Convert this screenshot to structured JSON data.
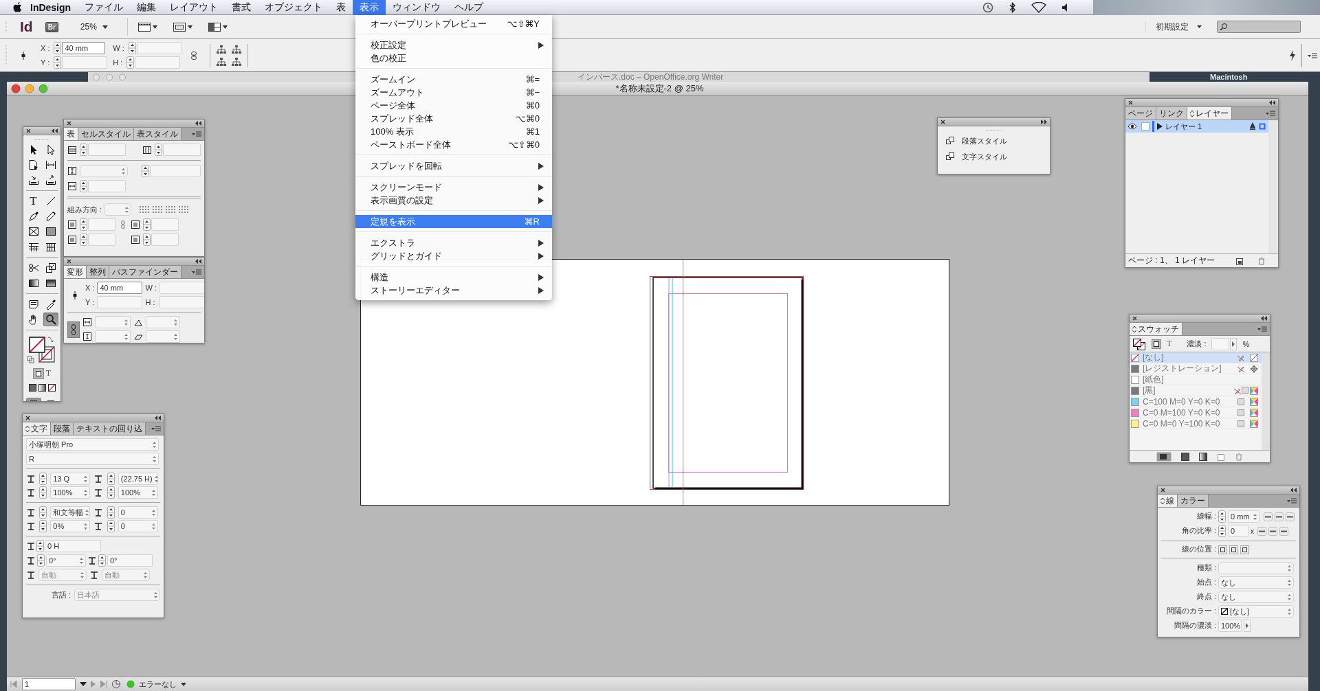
{
  "menubar": {
    "items": [
      {
        "label": "InDesign",
        "selected": false
      },
      {
        "label": "ファイル",
        "selected": false
      },
      {
        "label": "編集",
        "selected": false
      },
      {
        "label": "レイアウト",
        "selected": false
      },
      {
        "label": "書式",
        "selected": false
      },
      {
        "label": "オブジェクト",
        "selected": false
      },
      {
        "label": "表",
        "selected": false
      },
      {
        "label": "表示",
        "selected": true
      },
      {
        "label": "ウィンドウ",
        "selected": false
      },
      {
        "label": "ヘルプ",
        "selected": false
      }
    ]
  },
  "app_bar": {
    "logo": "Id",
    "bridge": "Br",
    "zoom": "25%",
    "workspace": "初期設定"
  },
  "control_panel": {
    "fields": [
      {
        "label": "X :",
        "value": "40 mm"
      },
      {
        "label": "Y :"
      },
      {
        "label": "W :"
      },
      {
        "label": "H :"
      }
    ]
  },
  "background_window": {
    "title": "インバース.doc – OpenOffice.org Writer"
  },
  "desktop": {
    "volume": "Macintosh"
  },
  "document": {
    "title": "*名称未設定-2 @ 25%"
  },
  "view_menu": {
    "items": [
      {
        "kind": "item",
        "label": "オーバープリントプレビュー",
        "shortcut": "⌥⇧⌘Y",
        "submenu": false,
        "selected": false
      },
      {
        "kind": "separator"
      },
      {
        "kind": "item",
        "label": "校正設定",
        "submenu": true,
        "selected": false
      },
      {
        "kind": "item",
        "label": "色の校正",
        "submenu": false,
        "selected": false
      },
      {
        "kind": "separator"
      },
      {
        "kind": "item",
        "label": "ズームイン",
        "shortcut": "⌘=",
        "submenu": false,
        "selected": false
      },
      {
        "kind": "item",
        "label": "ズームアウト",
        "shortcut": "⌘−",
        "submenu": false,
        "selected": false
      },
      {
        "kind": "item",
        "label": "ページ全体",
        "shortcut": "⌘0",
        "submenu": false,
        "selected": false
      },
      {
        "kind": "item",
        "label": "スプレッド全体",
        "shortcut": "⌥⌘0",
        "submenu": false,
        "selected": false
      },
      {
        "kind": "item",
        "label": "100% 表示",
        "shortcut": "⌘1",
        "submenu": false,
        "selected": false
      },
      {
        "kind": "item",
        "label": "ペーストボード全体",
        "shortcut": "⌥⇧⌘0",
        "submenu": false,
        "selected": false
      },
      {
        "kind": "separator"
      },
      {
        "kind": "item",
        "label": "スプレッドを回転",
        "submenu": true,
        "selected": false
      },
      {
        "kind": "separator"
      },
      {
        "kind": "item",
        "label": "スクリーンモード",
        "submenu": true,
        "selected": false
      },
      {
        "kind": "item",
        "label": "表示画質の設定",
        "submenu": true,
        "selected": false
      },
      {
        "kind": "separator"
      },
      {
        "kind": "item",
        "label": "定規を表示",
        "shortcut": "⌘R",
        "submenu": false,
        "selected": true
      },
      {
        "kind": "separator"
      },
      {
        "kind": "item",
        "label": "エクストラ",
        "submenu": true,
        "selected": false
      },
      {
        "kind": "item",
        "label": "グリッドとガイド",
        "submenu": true,
        "selected": false
      },
      {
        "kind": "separator"
      },
      {
        "kind": "item",
        "label": "構造",
        "submenu": true,
        "selected": false
      },
      {
        "kind": "item",
        "label": "ストーリーエディター",
        "submenu": true,
        "selected": false
      }
    ]
  },
  "toolbox": {
    "tools": [
      {
        "kind": "select",
        "selected": false
      },
      {
        "kind": "direct",
        "selected": false
      },
      {
        "kind": "page",
        "selected": false
      },
      {
        "kind": "gap",
        "selected": false
      },
      {
        "kind": "collector",
        "selected": false
      },
      {
        "kind": "placer",
        "selected": false
      },
      {
        "kind": "type",
        "glyph": "T",
        "selected": false
      },
      {
        "kind": "line",
        "selected": false
      },
      {
        "kind": "pen",
        "selected": false
      },
      {
        "kind": "pencil",
        "selected": false
      },
      {
        "kind": "frame",
        "selected": false
      },
      {
        "kind": "rect",
        "selected": false
      },
      {
        "kind": "grid",
        "selected": false
      },
      {
        "kind": "grid2",
        "selected": false
      },
      {
        "kind": "scissors",
        "selected": false
      },
      {
        "kind": "transform",
        "selected": false
      },
      {
        "kind": "gradient",
        "selected": false
      },
      {
        "kind": "feather",
        "selected": false
      },
      {
        "kind": "note",
        "selected": false
      },
      {
        "kind": "eyedropper",
        "selected": false
      },
      {
        "kind": "hand",
        "selected": false
      },
      {
        "kind": "zoom",
        "selected": true
      }
    ],
    "text_glyph": "T"
  },
  "table_panel": {
    "tabs": [
      {
        "label": "表",
        "selected": true,
        "options": false
      },
      {
        "label": "セルスタイル",
        "selected": false,
        "options": false
      },
      {
        "label": "表スタイル",
        "selected": false,
        "options": false
      }
    ],
    "direction_label": "組み方向 :"
  },
  "transform_panel": {
    "tabs": [
      {
        "label": "変形",
        "selected": true,
        "options": false
      },
      {
        "label": "整列",
        "selected": false,
        "options": false
      },
      {
        "label": "パスファインダー",
        "selected": false,
        "options": false
      }
    ],
    "fields": [
      {
        "label": "X :",
        "value": "40 mm"
      },
      {
        "label": "Y :"
      },
      {
        "label": "W :"
      },
      {
        "label": "H :"
      }
    ]
  },
  "character_panel": {
    "tabs": [
      {
        "label": "文字",
        "selected": true,
        "options": true
      },
      {
        "label": "段落",
        "selected": false,
        "options": false
      },
      {
        "label": "テキストの回り込",
        "selected": false,
        "options": false
      }
    ],
    "font": "小塚明朝 Pro",
    "style": "R",
    "fields": [
      {
        "value": "13 Q"
      },
      {
        "value": "(22.75 H)"
      },
      {
        "value": "100%"
      },
      {
        "value": "100%"
      },
      {
        "value": "和文等幅"
      },
      {
        "value": "0"
      },
      {
        "value": "0%"
      },
      {
        "value": "0"
      }
    ],
    "baseline": "0 H",
    "rotation": [
      {
        "value": "0°"
      },
      {
        "value": "0°"
      }
    ],
    "auto": [
      {
        "value": "自動"
      },
      {
        "value": "自動"
      }
    ],
    "language_label": "言語 :",
    "language": "日本語"
  },
  "styles_panel": {
    "items": [
      {
        "label": "段落スタイル"
      },
      {
        "label": "文字スタイル"
      }
    ]
  },
  "layers_panel": {
    "tabs": [
      {
        "label": "ページ",
        "selected": false,
        "options": false
      },
      {
        "label": "リンク",
        "selected": false,
        "options": false
      },
      {
        "label": "レイヤー",
        "selected": true,
        "options": true
      }
    ],
    "layers": [
      {
        "name": "レイヤー 1",
        "selected": true,
        "visible": true,
        "color": "#3366ff"
      }
    ],
    "status": "ページ : 1、 1 レイヤー"
  },
  "swatches_panel": {
    "tabs": [
      {
        "label": "スウォッチ",
        "selected": true,
        "options": true
      }
    ],
    "tint_label": "濃淡 :",
    "percent": "%",
    "text_glyph": "T",
    "swatches": [
      {
        "name": "[なし]",
        "kind": "none",
        "selected": true,
        "locked": true
      },
      {
        "name": "[レジストレーション]",
        "kind": "registration",
        "color": "#7a7a7a",
        "selected": false,
        "locked": true
      },
      {
        "name": "[紙色]",
        "kind": "paper",
        "color": "#ffffff",
        "selected": false,
        "locked": false
      },
      {
        "name": "[黒]",
        "kind": "process",
        "color": "#7a7a7a",
        "selected": false,
        "locked": true
      },
      {
        "name": "C=100 M=0 Y=0 K=0",
        "kind": "process",
        "color": "#80d0f2",
        "selected": false,
        "locked": false
      },
      {
        "name": "C=0 M=100 Y=0 K=0",
        "kind": "process",
        "color": "#ef80be",
        "selected": false,
        "locked": false
      },
      {
        "name": "C=0 M=0 Y=100 K=0",
        "kind": "process",
        "color": "#fbf38a",
        "selected": false,
        "locked": false
      }
    ]
  },
  "stroke_panel": {
    "tabs": [
      {
        "label": "線",
        "selected": true,
        "options": true
      },
      {
        "label": "カラー",
        "selected": false,
        "options": false
      }
    ],
    "fields": [
      {
        "kind": "spin",
        "label": "線幅 :",
        "value": "0 mm"
      },
      {
        "kind": "ratio",
        "label": "角の比率 :",
        "value": "0",
        "suffix": "x"
      },
      {
        "kind": "position",
        "label": "線の位置 :"
      },
      {
        "kind": "select",
        "label": "種類 :"
      },
      {
        "kind": "select",
        "label": "始点 :",
        "value": "なし"
      },
      {
        "kind": "select",
        "label": "終点 :",
        "value": "なし"
      },
      {
        "kind": "color",
        "label": "間隔のカラー :",
        "value": "[なし]"
      },
      {
        "kind": "tint",
        "label": "間隔の濃淡 :",
        "value": "100%"
      }
    ]
  },
  "status_bar": {
    "page": "1",
    "preflight": "エラーなし"
  }
}
